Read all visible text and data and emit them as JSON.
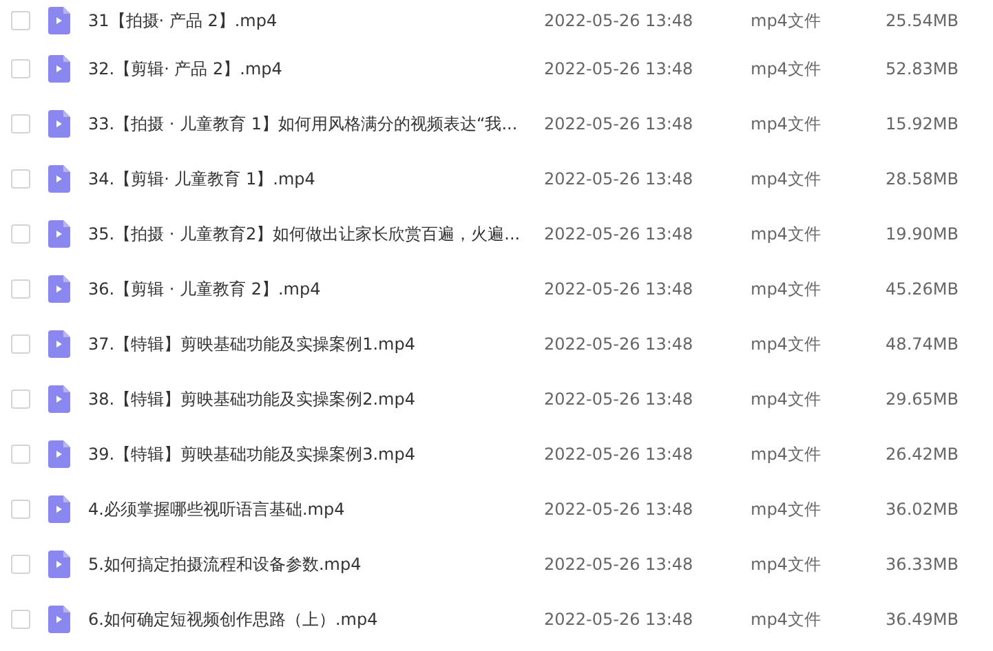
{
  "files": [
    {
      "name": "31【拍摄· 产品 2】.mp4",
      "modified": "2022-05-26 13:48",
      "type": "mp4文件",
      "size": "25.54MB",
      "checked": false
    },
    {
      "name": "32.【剪辑· 产品 2】.mp4",
      "modified": "2022-05-26 13:48",
      "type": "mp4文件",
      "size": "52.83MB",
      "checked": false
    },
    {
      "name": "33.【拍摄 · 儿童教育 1】如何用风格满分的视频表达“我...",
      "modified": "2022-05-26 13:48",
      "type": "mp4文件",
      "size": "15.92MB",
      "checked": false
    },
    {
      "name": "34.【剪辑· 儿童教育 1】.mp4",
      "modified": "2022-05-26 13:48",
      "type": "mp4文件",
      "size": "28.58MB",
      "checked": false
    },
    {
      "name": "35.【拍摄 · 儿童教育2】如何做出让家长欣赏百遍，火遍...",
      "modified": "2022-05-26 13:48",
      "type": "mp4文件",
      "size": "19.90MB",
      "checked": false
    },
    {
      "name": "36.【剪辑 · 儿童教育 2】.mp4",
      "modified": "2022-05-26 13:48",
      "type": "mp4文件",
      "size": "45.26MB",
      "checked": false
    },
    {
      "name": "37.【特辑】剪映基础功能及实操案例1.mp4",
      "modified": "2022-05-26 13:48",
      "type": "mp4文件",
      "size": "48.74MB",
      "checked": false
    },
    {
      "name": "38.【特辑】剪映基础功能及实操案例2.mp4",
      "modified": "2022-05-26 13:48",
      "type": "mp4文件",
      "size": "29.65MB",
      "checked": false
    },
    {
      "name": "39.【特辑】剪映基础功能及实操案例3.mp4",
      "modified": "2022-05-26 13:48",
      "type": "mp4文件",
      "size": "26.42MB",
      "checked": false
    },
    {
      "name": "4.必须掌握哪些视听语言基础.mp4",
      "modified": "2022-05-26 13:48",
      "type": "mp4文件",
      "size": "36.02MB",
      "checked": false
    },
    {
      "name": "5.如何搞定拍摄流程和设备参数.mp4",
      "modified": "2022-05-26 13:48",
      "type": "mp4文件",
      "size": "36.33MB",
      "checked": false
    },
    {
      "name": "6.如何确定短视频创作思路（上）.mp4",
      "modified": "2022-05-26 13:48",
      "type": "mp4文件",
      "size": "36.49MB",
      "checked": false
    }
  ]
}
